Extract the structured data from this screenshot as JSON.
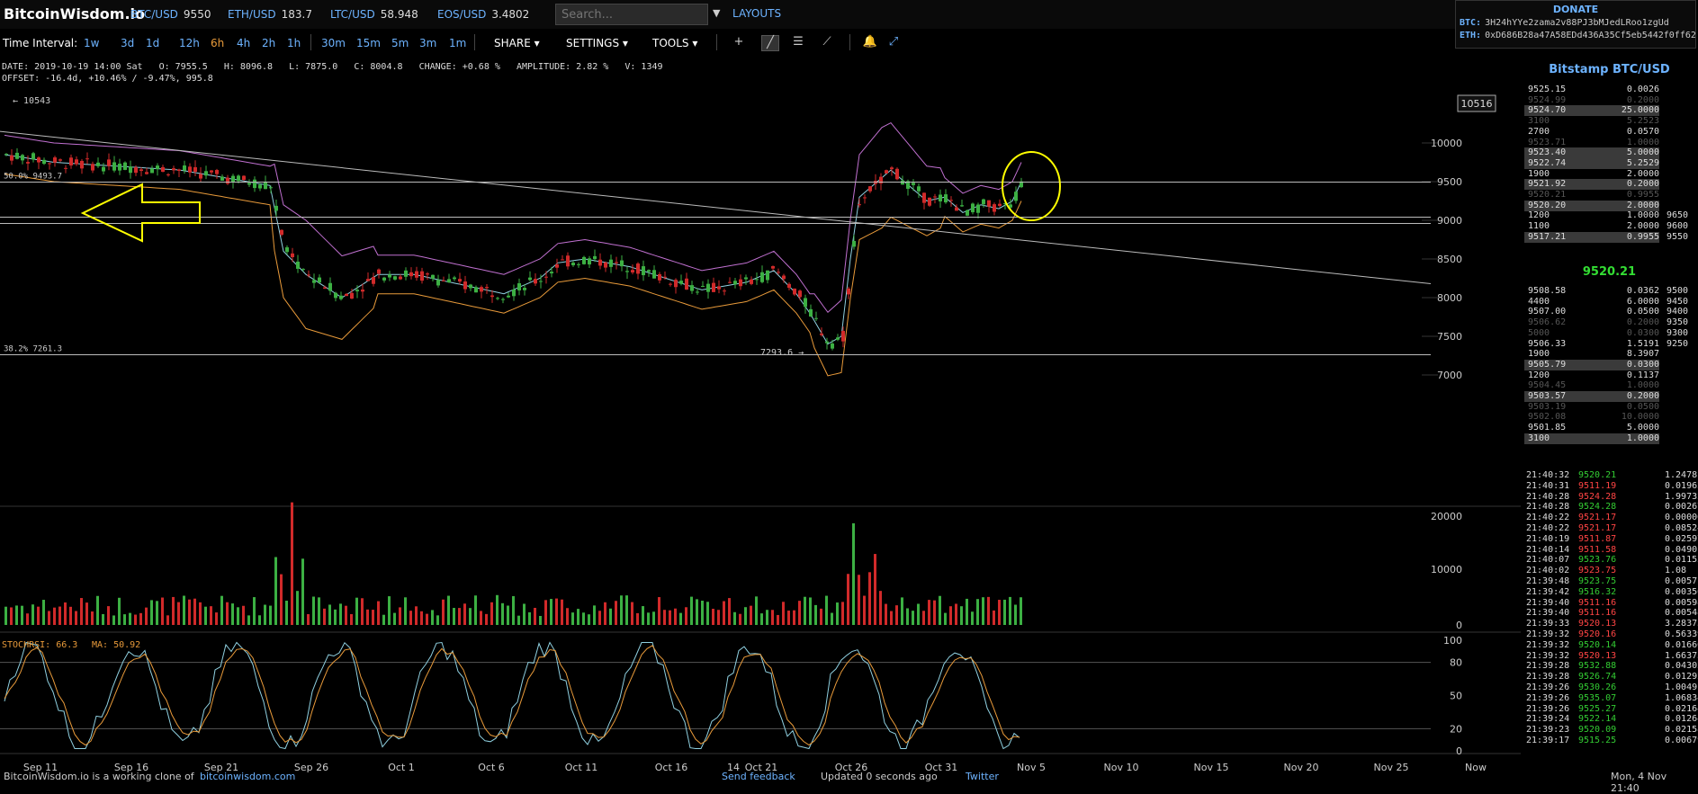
{
  "brand": "BitcoinWisdom.io",
  "tickers": [
    {
      "symbol": "BTC/USD",
      "value": "9550"
    },
    {
      "symbol": "ETH/USD",
      "value": "183.7"
    },
    {
      "symbol": "LTC/USD",
      "value": "58.948"
    },
    {
      "symbol": "EOS/USD",
      "value": "3.4802"
    }
  ],
  "search": {
    "placeholder": "Search..."
  },
  "layouts_label": "LAYOUTS",
  "donate": {
    "title": "DONATE",
    "btc_label": "BTC:",
    "btc_address": "3H24hYYe2zama2v88PJ3bMJedLRoo1zgUd",
    "eth_label": "ETH:",
    "eth_address": "0xD686B28a47A58EDd436A35Cf5eb5442f0ff62"
  },
  "toolbar": {
    "interval_label": "Time Interval:",
    "intervals_a": [
      "1w",
      "3d",
      "1d"
    ],
    "intervals_b": [
      "12h",
      "6h",
      "4h",
      "2h",
      "1h"
    ],
    "intervals_c": [
      "30m",
      "15m",
      "5m",
      "3m",
      "1m"
    ],
    "active_interval": "6h",
    "share": "SHARE",
    "settings": "SETTINGS",
    "tools": "TOOLS"
  },
  "info": {
    "line1": "DATE: 2019-10-19 14:00 Sat   O: 7955.5   H: 8096.8   L: 7875.0   C: 8004.8   CHANGE: +0.68 %   AMPLITUDE: 2.82 %   V: 1349",
    "line2": "OFFSET: -16.4d, +10.46% / -9.47%, 995.8"
  },
  "chart_data": {
    "type": "candlestick",
    "price_axis": [
      "10000",
      "9500",
      "9000",
      "8500",
      "8000",
      "7500",
      "7000"
    ],
    "current_price_label": "10516",
    "high_marker": "10543",
    "low_marker": "7293.6",
    "fib_levels": [
      {
        "label": "50.0% 9493.7",
        "price": 9493.7
      },
      {
        "label": "38.2% 7261.3",
        "price": 7261.3
      }
    ],
    "volume_axis": [
      "20000",
      "10000",
      "0"
    ],
    "stochrsi_label": "STOCHRSI: 66.3",
    "ma_label": "MA: 50.92",
    "stochrsi_axis": [
      "100",
      "80",
      "50",
      "20",
      "0"
    ],
    "date_axis": [
      "Sep 11",
      "Sep 16",
      "Sep 21",
      "Sep 26",
      "Oct 1",
      "Oct 6",
      "Oct 11",
      "Oct 16",
      "14",
      "Oct 21",
      "Oct 26",
      "Oct 31",
      "Nov 5",
      "Nov 10",
      "Nov 15",
      "Nov 20",
      "Nov 25",
      "Now"
    ],
    "colors": {
      "up": "#3cb043",
      "down": "#d12a2a",
      "boll_upper": "#c070d0",
      "boll_lower": "#e89a3a",
      "ma": "#8fd0e0",
      "highlight": "#ffff00"
    }
  },
  "orderbook": {
    "title": "Bitstamp BTC/USD",
    "asks": [
      {
        "p": "9525.15",
        "a": "0.0026"
      },
      {
        "p": "9524.99",
        "a": "0.2000"
      },
      {
        "p": "9524.70",
        "a": "25.0000"
      },
      {
        "p": "3100",
        "a": "5.2523"
      },
      {
        "p": "2700",
        "a": "0.0570"
      },
      {
        "p": "9523.71",
        "a": "1.0000"
      },
      {
        "p": "9523.40",
        "a": "5.0000"
      },
      {
        "p": "9522.74",
        "a": "5.2529"
      },
      {
        "p": "1900",
        "a": "2.0000"
      },
      {
        "p": "9521.92",
        "a": "0.2000"
      },
      {
        "p": "9520.21",
        "a": "0.9955"
      },
      {
        "p": "9520.20",
        "a": "2.0000"
      },
      {
        "p": "1200",
        "a": "1.0000"
      },
      {
        "p": "1100",
        "a": "2.0000"
      },
      {
        "p": "9517.21",
        "a": "0.9955"
      }
    ],
    "ask_depth": [
      "9650",
      "9600",
      "9550"
    ],
    "last_price": "9520.21",
    "bids": [
      {
        "p": "9508.58",
        "a": "0.0362"
      },
      {
        "p": "4400",
        "a": "6.0000"
      },
      {
        "p": "9507.00",
        "a": "0.0500"
      },
      {
        "p": "9506.62",
        "a": "0.2000"
      },
      {
        "p": "5000",
        "a": "0.0300"
      },
      {
        "p": "9506.33",
        "a": "1.5191"
      },
      {
        "p": "1900",
        "a": "8.3907"
      },
      {
        "p": "9505.79",
        "a": "0.0300"
      },
      {
        "p": "1200",
        "a": "0.1137"
      },
      {
        "p": "9504.45",
        "a": "1.0000"
      },
      {
        "p": "9503.57",
        "a": "0.2000"
      },
      {
        "p": "9503.19",
        "a": "0.0500"
      },
      {
        "p": "9502.08",
        "a": "10.0000"
      },
      {
        "p": "9501.85",
        "a": "5.0000"
      },
      {
        "p": "3100",
        "a": "1.0000"
      }
    ],
    "bid_depth": [
      "9500",
      "9450",
      "9400",
      "9350",
      "9300",
      "9250"
    ]
  },
  "trades": [
    {
      "t": "21:40:32",
      "p": "9520.21",
      "q": "1.24781",
      "side": "buy"
    },
    {
      "t": "21:40:31",
      "p": "9511.19",
      "q": "0.01962",
      "side": "sell"
    },
    {
      "t": "21:40:28",
      "p": "9524.28",
      "q": "1.99732",
      "side": "sell"
    },
    {
      "t": "21:40:28",
      "p": "9524.28",
      "q": "0.00267",
      "side": "buy"
    },
    {
      "t": "21:40:22",
      "p": "9521.17",
      "q": "0.00000",
      "side": "sell"
    },
    {
      "t": "21:40:22",
      "p": "9521.17",
      "q": "0.08524",
      "side": "sell"
    },
    {
      "t": "21:40:19",
      "p": "9511.87",
      "q": "0.02597",
      "side": "sell"
    },
    {
      "t": "21:40:14",
      "p": "9511.58",
      "q": "0.04901",
      "side": "sell"
    },
    {
      "t": "21:40:07",
      "p": "9523.76",
      "q": "0.01152",
      "side": "buy"
    },
    {
      "t": "21:40:02",
      "p": "9523.75",
      "q": "1.08",
      "side": "sell"
    },
    {
      "t": "21:39:48",
      "p": "9523.75",
      "q": "0.00571",
      "side": "buy"
    },
    {
      "t": "21:39:42",
      "p": "9516.32",
      "q": "0.00356",
      "side": "buy"
    },
    {
      "t": "21:39:40",
      "p": "9511.16",
      "q": "0.00598",
      "side": "sell"
    },
    {
      "t": "21:39:40",
      "p": "9511.16",
      "q": "0.00548",
      "side": "sell"
    },
    {
      "t": "21:39:33",
      "p": "9520.13",
      "q": "3.28373",
      "side": "sell"
    },
    {
      "t": "21:39:32",
      "p": "9520.16",
      "q": "0.56339",
      "side": "sell"
    },
    {
      "t": "21:39:32",
      "p": "9520.14",
      "q": "0.01660",
      "side": "buy"
    },
    {
      "t": "21:39:32",
      "p": "9520.13",
      "q": "1.66373",
      "side": "sell"
    },
    {
      "t": "21:39:28",
      "p": "9532.88",
      "q": "0.04302",
      "side": "buy"
    },
    {
      "t": "21:39:28",
      "p": "9526.74",
      "q": "0.01292",
      "side": "buy"
    },
    {
      "t": "21:39:26",
      "p": "9530.26",
      "q": "1.00491",
      "side": "buy"
    },
    {
      "t": "21:39:26",
      "p": "9535.07",
      "q": "1.06834",
      "side": "buy"
    },
    {
      "t": "21:39:26",
      "p": "9525.27",
      "q": "0.02164",
      "side": "buy"
    },
    {
      "t": "21:39:24",
      "p": "9522.14",
      "q": "0.01264",
      "side": "buy"
    },
    {
      "t": "21:39:23",
      "p": "9520.09",
      "q": "0.02158",
      "side": "buy"
    },
    {
      "t": "21:39:17",
      "p": "9515.25",
      "q": "0.00679",
      "side": "buy"
    }
  ],
  "footer": {
    "clone_text": "BitcoinWisdom.io is a working clone of",
    "clone_link": "bitcoinwisdom.com",
    "feedback": "Send feedback",
    "updated": "Updated 0 seconds ago",
    "twitter": "Twitter",
    "clock": "Mon, 4 Nov 21:40"
  }
}
